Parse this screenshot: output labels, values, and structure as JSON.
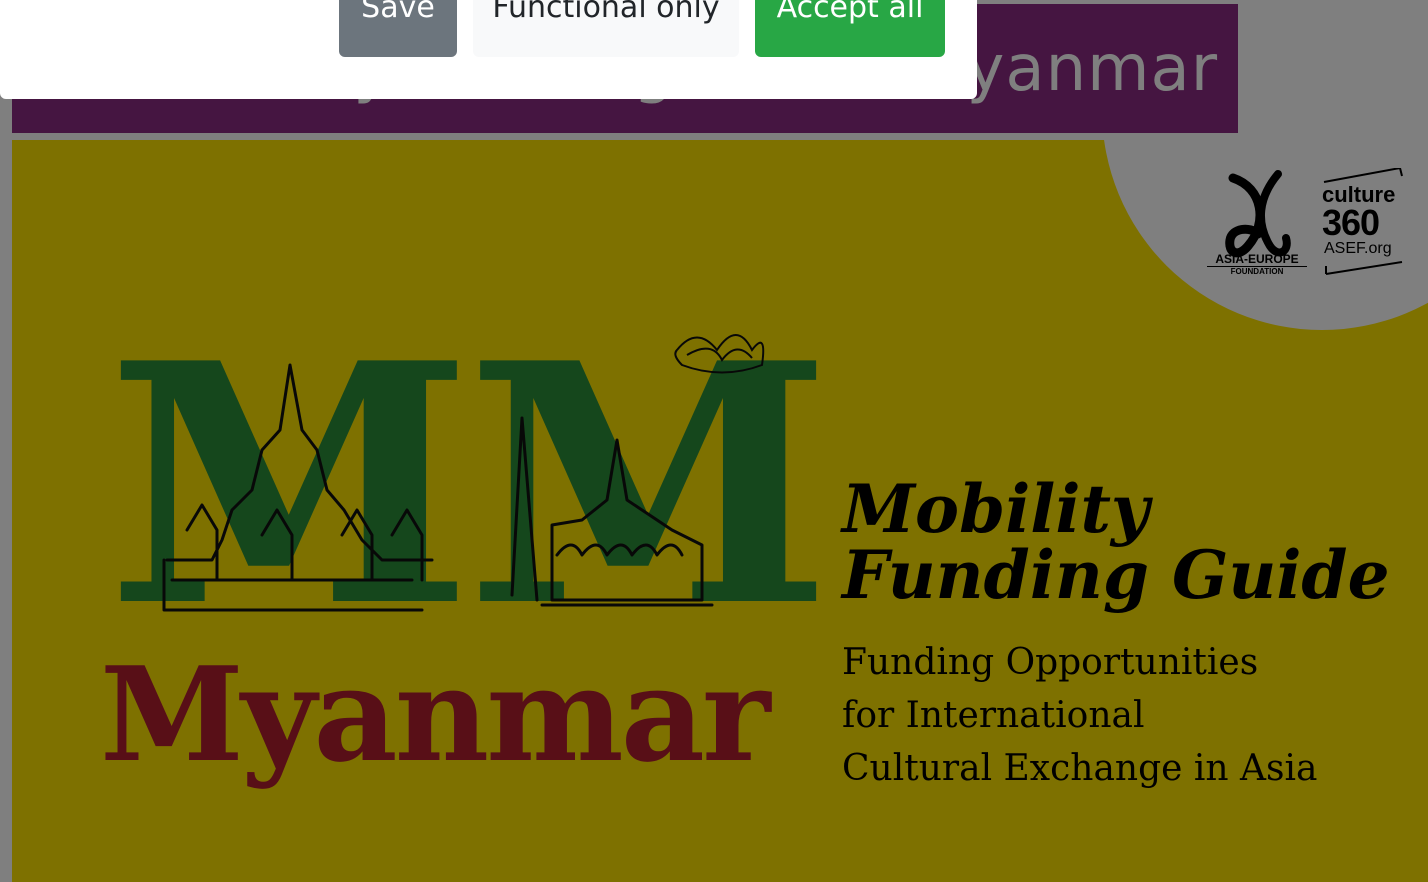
{
  "page": {
    "header_title": "Mobility Funding Guide Myanmar",
    "cover": {
      "monogram": "MM",
      "country": "Myanmar",
      "guide_title_line1": "Mobility",
      "guide_title_line2": "Funding Guide",
      "subtitle_line1": "Funding Opportunities",
      "subtitle_line2": "for International",
      "subtitle_line3": "Cultural Exchange in Asia",
      "logos": {
        "asef_line1": "ASIA-EUROPE",
        "asef_line2": "FOUNDATION",
        "culture_word": "culture",
        "culture_number": "360",
        "culture_domain": "ASEF.org"
      }
    }
  },
  "consent": {
    "save_label": "Save",
    "functional_label": "Functional only",
    "accept_label": "Accept all"
  },
  "colors": {
    "header_band": "#8a2a82",
    "cover_bg": "#fde300",
    "monogram": "#2a8f39",
    "country": "#b01e2e",
    "save_button": "#6c757d",
    "functional_button": "#f8f9fa",
    "accept_button": "#28a745"
  },
  "icons": [
    "asef-logo-icon",
    "culture360-logo-icon",
    "pagoda-sketch-icon",
    "lotus-icon"
  ]
}
